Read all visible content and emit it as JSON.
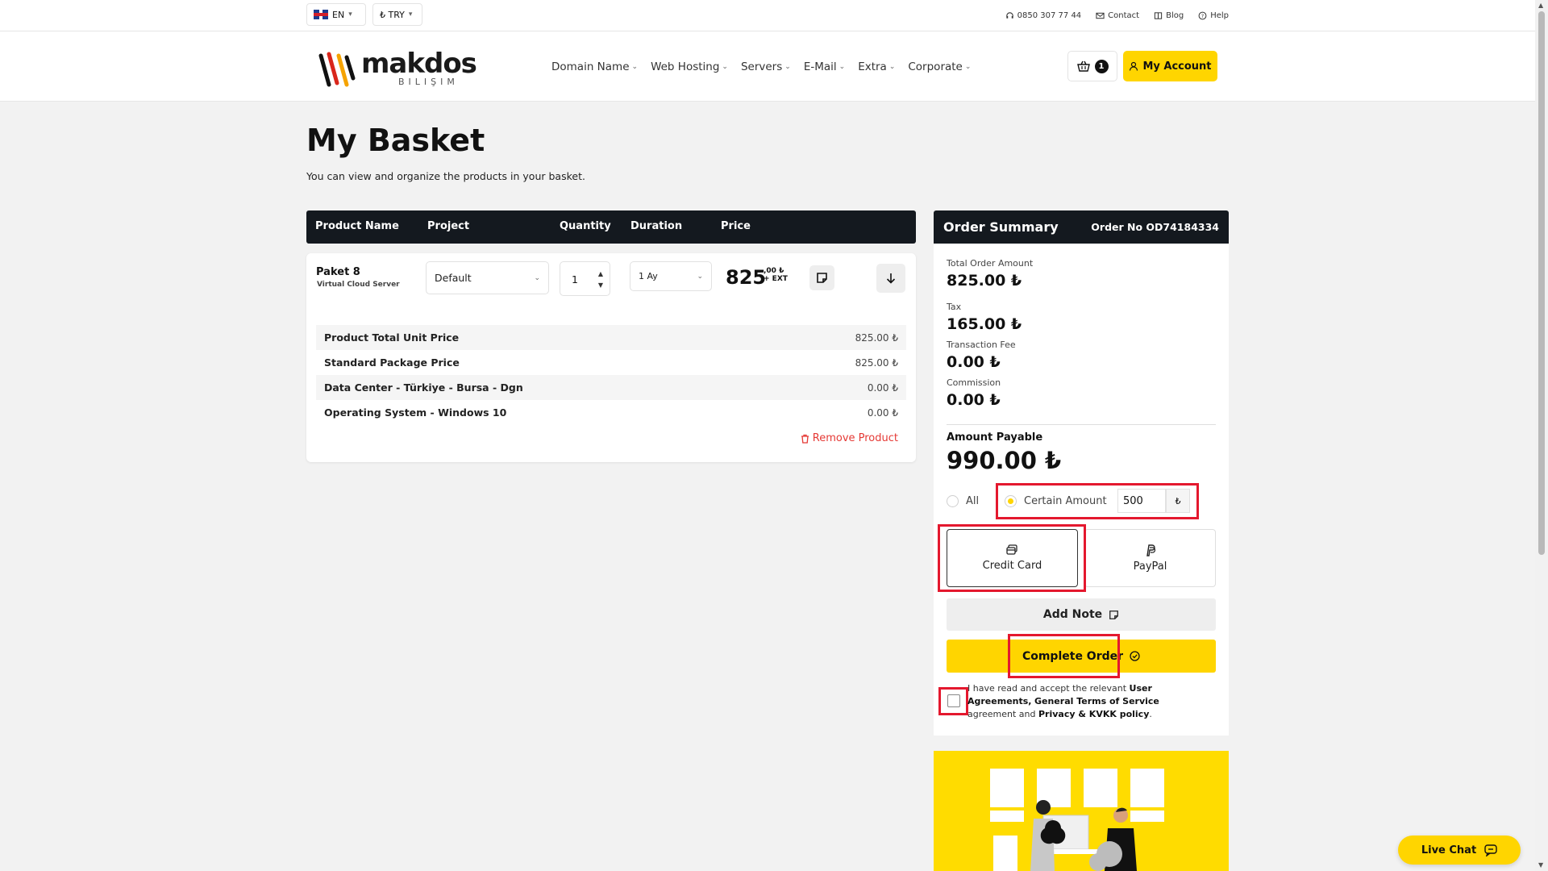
{
  "topbar": {
    "language": "EN",
    "currency": "₺ TRY",
    "phone": "0850 307 77 44",
    "contact": "Contact",
    "blog": "Blog",
    "help": "Help"
  },
  "header": {
    "logo_name": "makdos",
    "logo_sub": "BILIŞIM",
    "nav": [
      "Domain Name",
      "Web Hosting",
      "Servers",
      "E-Mail",
      "Extra",
      "Corporate"
    ],
    "cart_count": "1",
    "account_label": "My Account"
  },
  "page": {
    "title": "My Basket",
    "subtitle": "You can view and organize the products in your basket."
  },
  "table": {
    "columns": [
      "Product Name",
      "Project",
      "Quantity",
      "Duration",
      "Price"
    ],
    "product": {
      "name": "Paket 8",
      "type": "Virtual Cloud Server",
      "project": "Default",
      "quantity": "1",
      "duration": "1 Ay",
      "price_main": "825",
      "price_cents": ",00 ₺",
      "price_ext": "+ EXT"
    },
    "rows": [
      {
        "label": "Product Total Unit Price",
        "value": "825.00 ₺"
      },
      {
        "label": "Standard Package Price",
        "value": "825.00 ₺"
      },
      {
        "label": "Data Center - Türkiye - Bursa - Dgn",
        "value": "0.00 ₺"
      },
      {
        "label": "Operating System - Windows 10",
        "value": "0.00 ₺"
      }
    ],
    "remove_label": "Remove Product"
  },
  "summary": {
    "title": "Order Summary",
    "order_no": "Order No OD74184334",
    "total_label": "Total Order Amount",
    "total": "825.00 ₺",
    "tax_label": "Tax",
    "tax": "165.00 ₺",
    "fee_label": "Transaction Fee",
    "fee": "0.00 ₺",
    "commission_label": "Commission",
    "commission": "0.00 ₺",
    "payable_label": "Amount Payable",
    "payable": "990.00 ₺",
    "option_all": "All",
    "option_certain": "Certain Amount",
    "certain_value": "500",
    "currency_symbol": "₺",
    "pay_credit": "Credit Card",
    "pay_paypal": "PayPal",
    "add_note": "Add Note",
    "complete": "Complete Order",
    "terms_1": "I have read and accept the relevant ",
    "terms_user": "User Agreements,",
    "terms_2": " ",
    "terms_general": "General Terms of Service",
    "terms_3": " agreement and ",
    "terms_privacy": "Privacy & KVKK policy",
    "terms_4": "."
  },
  "chat": {
    "label": "Live Chat"
  },
  "colors": {
    "accent": "#ffd500",
    "dark": "#14191f",
    "highlight": "#e4182e",
    "danger": "#e53935"
  }
}
